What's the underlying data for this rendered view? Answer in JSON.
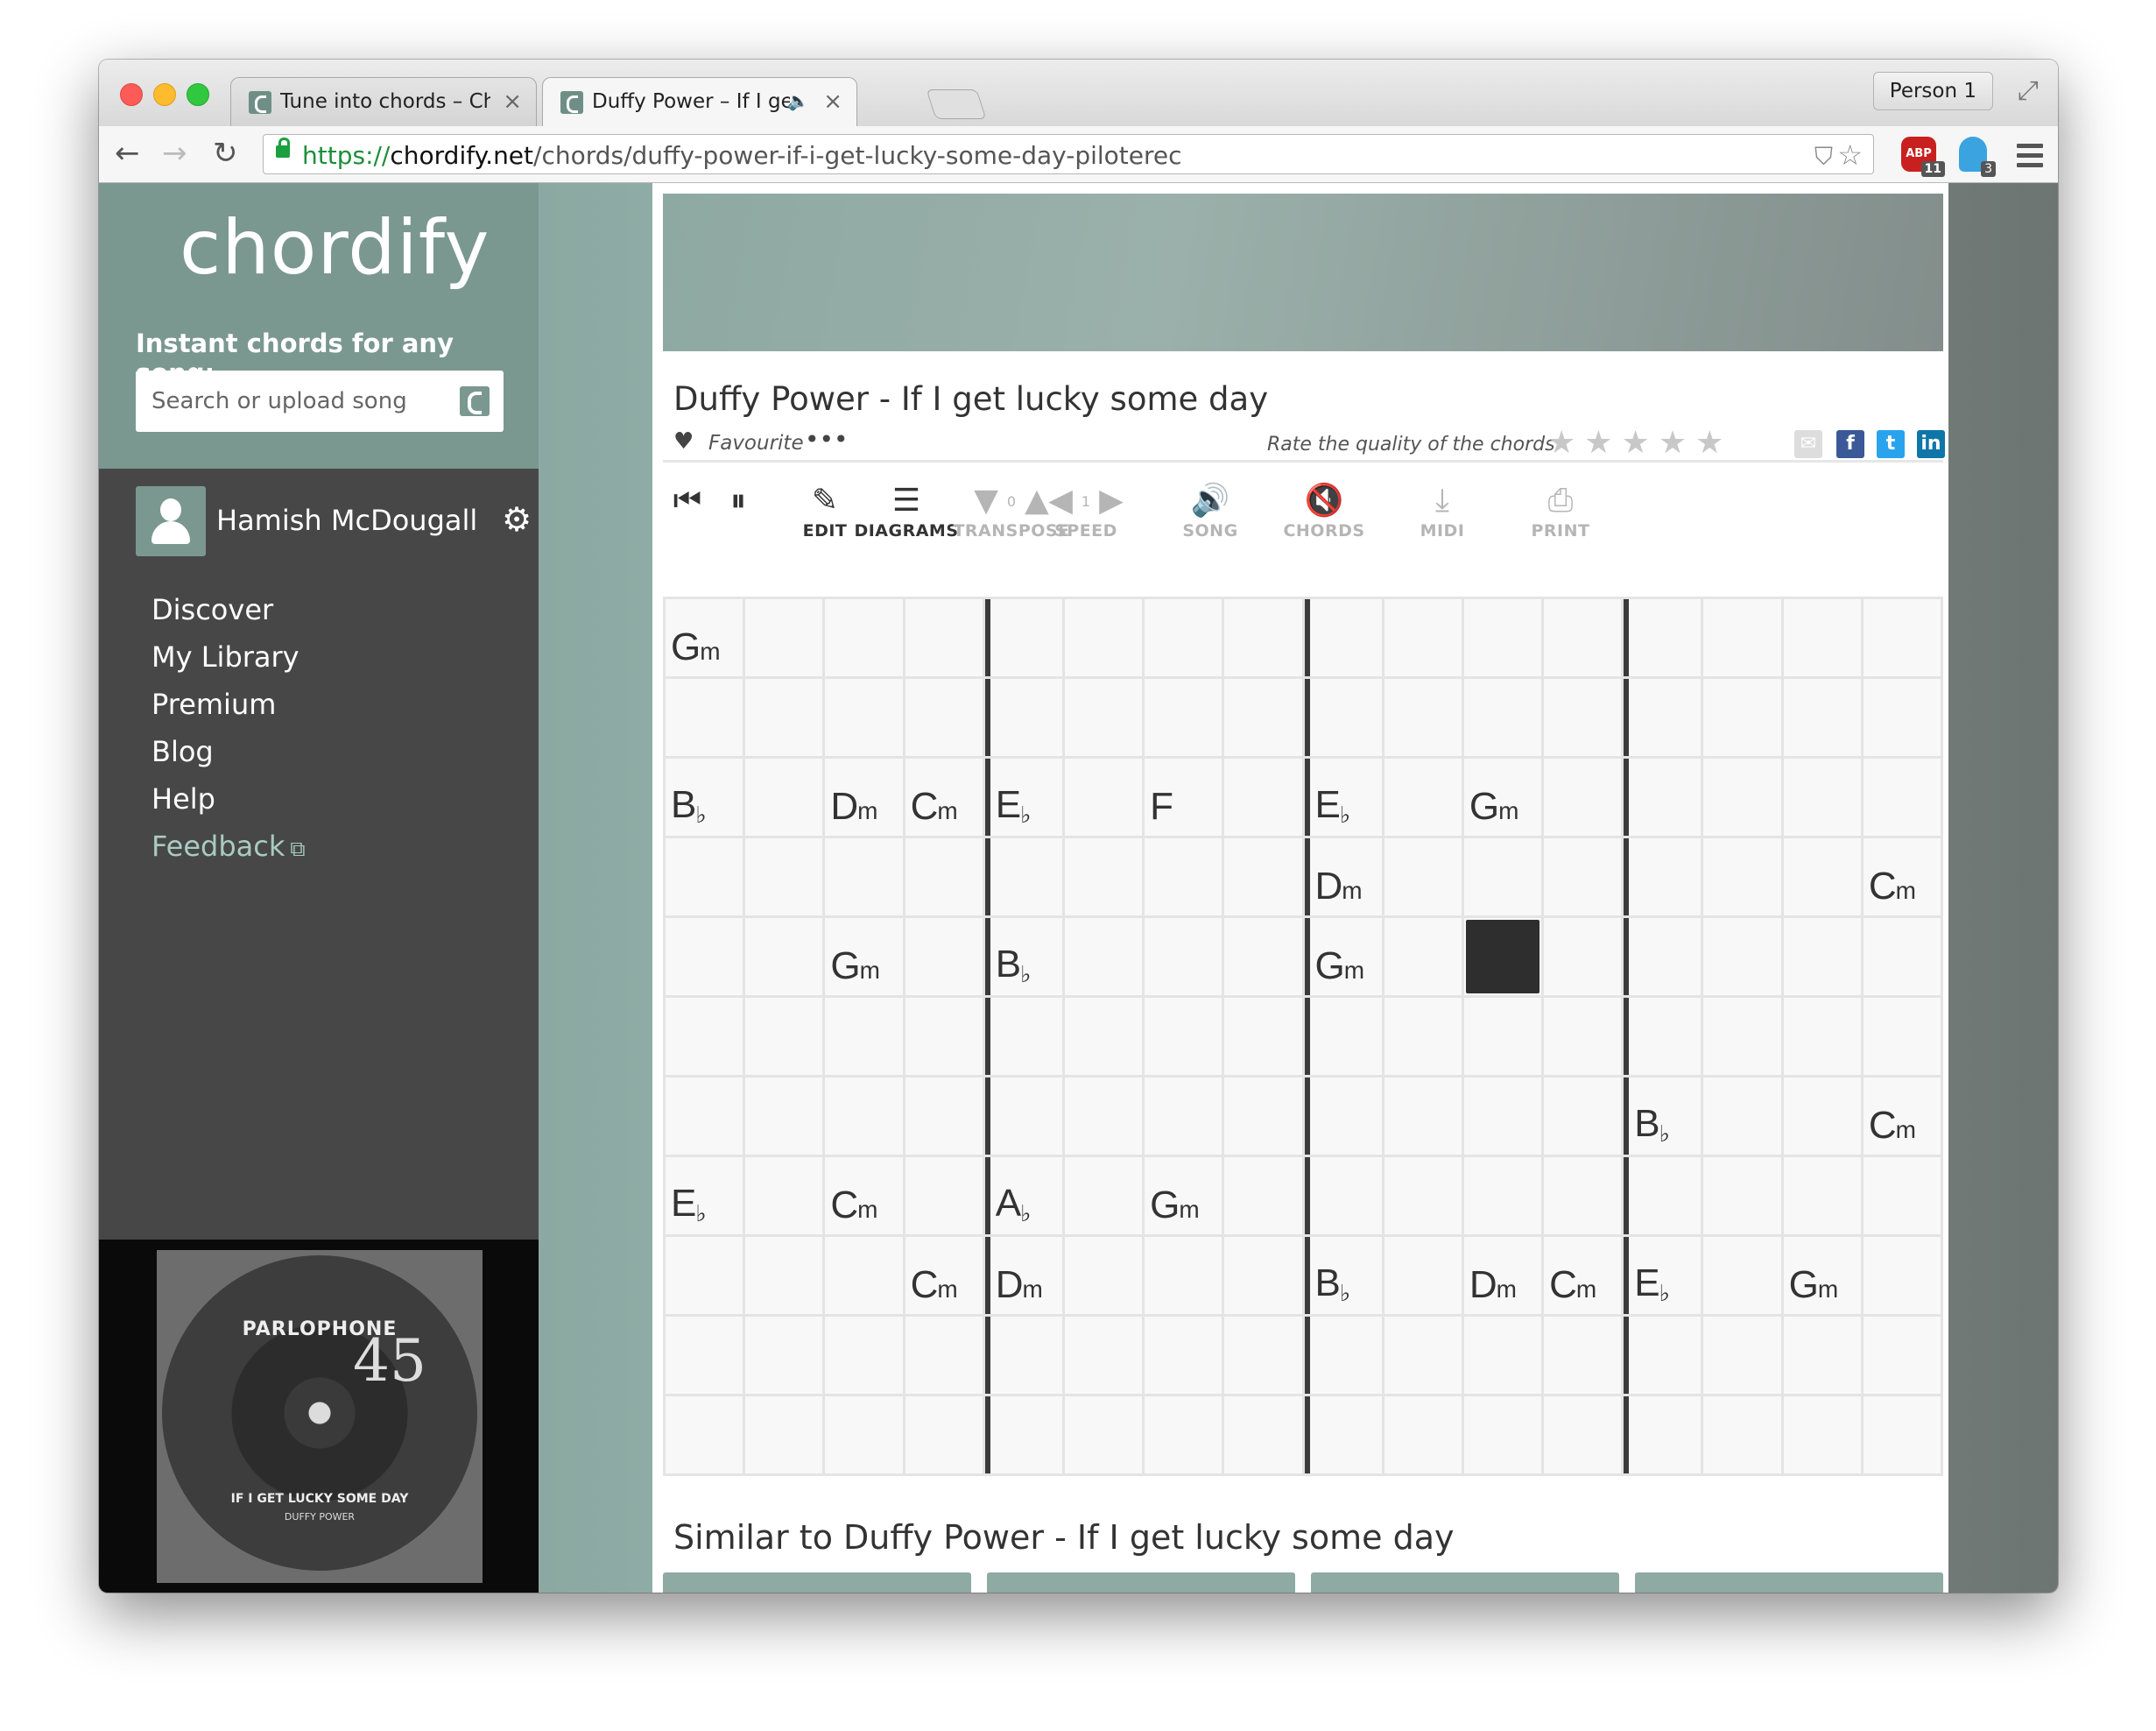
{
  "browser": {
    "tabs": [
      {
        "title": "Tune into chords – Chordif",
        "active": false,
        "audio": false
      },
      {
        "title": "Duffy Power – If I get lu",
        "active": true,
        "audio": true
      }
    ],
    "person": "Person 1",
    "url": {
      "scheme": "https://",
      "host": "chordify.net",
      "path": "/chords/duffy-power-if-i-get-lucky-some-day-piloterec"
    },
    "extensions": {
      "abp_label": "ABP",
      "abp_count": "11",
      "ghostery_count": "3"
    }
  },
  "sidebar": {
    "logo": "chordify",
    "tagline": "Instant chords for any song:",
    "search_placeholder": "Search or upload song",
    "user_name": "Hamish McDougall",
    "nav": [
      "Discover",
      "My Library",
      "Premium",
      "Blog",
      "Help",
      "Feedback"
    ],
    "album": {
      "brand": "PARLOPHONE",
      "rpm": "45",
      "title": "IF I GET LUCKY SOME DAY",
      "artist": "DUFFY POWER"
    }
  },
  "song": {
    "title": "Duffy Power - If I get lucky some day",
    "favourite_label": "Favourite",
    "more_label": "•••",
    "rate_label": "Rate the quality of the chords:",
    "stars": "★★★★★"
  },
  "controls": {
    "edit": "EDIT",
    "diagrams": "DIAGRAMS",
    "transpose": "TRANSPOSE",
    "transpose_value": "0",
    "speed": "SPEED",
    "speed_value": "1",
    "song": "SONG",
    "chords": "CHORDS",
    "midi": "MIDI",
    "print": "PRINT"
  },
  "chord_grid": {
    "columns": 16,
    "bar_columns": [
      4,
      8,
      12
    ],
    "current_cell": [
      4,
      10
    ],
    "rows": [
      [
        "Gm",
        "",
        "",
        "",
        "",
        "",
        "",
        "",
        "",
        "",
        "",
        "",
        "",
        "",
        "",
        ""
      ],
      [
        "",
        "",
        "",
        "",
        "",
        "",
        "",
        "",
        "",
        "",
        "",
        "",
        "",
        "",
        "",
        ""
      ],
      [
        "Bb",
        "",
        "Dm",
        "Cm",
        "Eb",
        "",
        "F",
        "",
        "Eb",
        "",
        "Gm",
        "",
        "",
        "",
        "",
        ""
      ],
      [
        "",
        "",
        "",
        "",
        "",
        "",
        "",
        "",
        "Dm",
        "",
        "",
        "",
        "",
        "",
        "",
        "Cm"
      ],
      [
        "",
        "",
        "Gm",
        "",
        "Bb",
        "",
        "",
        "",
        "Gm",
        "",
        "",
        "",
        "",
        "",
        "",
        ""
      ],
      [
        "",
        "",
        "",
        "",
        "",
        "",
        "",
        "",
        "",
        "",
        "",
        "",
        "",
        "",
        "",
        ""
      ],
      [
        "",
        "",
        "",
        "",
        "",
        "",
        "",
        "",
        "",
        "",
        "",
        "",
        "Bb",
        "",
        "",
        "Cm"
      ],
      [
        "Eb",
        "",
        "Cm",
        "",
        "Ab",
        "",
        "Gm",
        "",
        "",
        "",
        "",
        "",
        "",
        "",
        "",
        ""
      ],
      [
        "",
        "",
        "",
        "Cm",
        "Dm",
        "",
        "",
        "",
        "Bb",
        "",
        "Dm",
        "Cm",
        "Eb",
        "",
        "Gm",
        ""
      ],
      [
        "",
        "",
        "",
        "",
        "",
        "",
        "",
        "",
        "",
        "",
        "",
        "",
        "",
        "",
        "",
        ""
      ],
      [
        "",
        "",
        "",
        "",
        "",
        "",
        "",
        "",
        "",
        "",
        "",
        "",
        "",
        "",
        "",
        ""
      ]
    ]
  },
  "similar": {
    "heading": "Similar to Duffy Power - If I get lucky some day"
  }
}
